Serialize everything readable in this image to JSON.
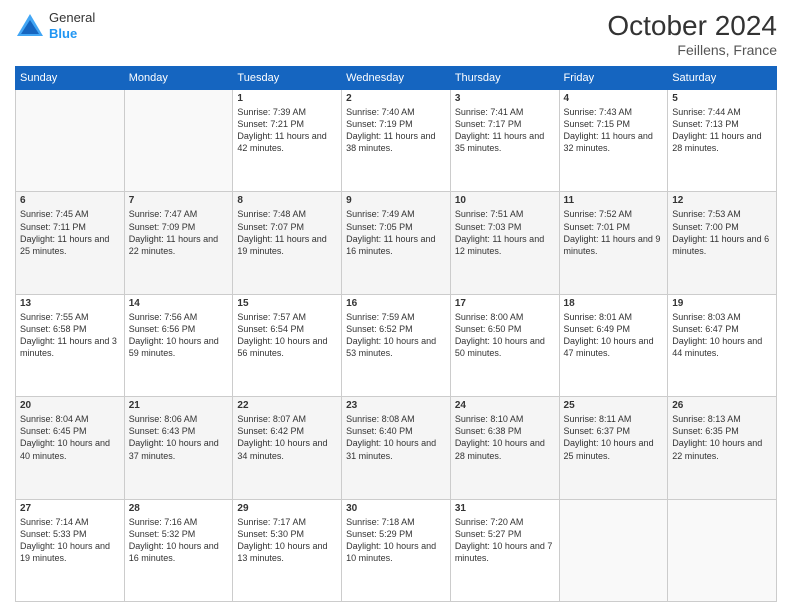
{
  "header": {
    "logo": {
      "general": "General",
      "blue": "Blue"
    },
    "title": "October 2024",
    "location": "Feillens, France"
  },
  "days_of_week": [
    "Sunday",
    "Monday",
    "Tuesday",
    "Wednesday",
    "Thursday",
    "Friday",
    "Saturday"
  ],
  "weeks": [
    [
      {
        "day": "",
        "info": ""
      },
      {
        "day": "",
        "info": ""
      },
      {
        "day": "1",
        "info": "Sunrise: 7:39 AM\nSunset: 7:21 PM\nDaylight: 11 hours and 42 minutes."
      },
      {
        "day": "2",
        "info": "Sunrise: 7:40 AM\nSunset: 7:19 PM\nDaylight: 11 hours and 38 minutes."
      },
      {
        "day": "3",
        "info": "Sunrise: 7:41 AM\nSunset: 7:17 PM\nDaylight: 11 hours and 35 minutes."
      },
      {
        "day": "4",
        "info": "Sunrise: 7:43 AM\nSunset: 7:15 PM\nDaylight: 11 hours and 32 minutes."
      },
      {
        "day": "5",
        "info": "Sunrise: 7:44 AM\nSunset: 7:13 PM\nDaylight: 11 hours and 28 minutes."
      }
    ],
    [
      {
        "day": "6",
        "info": "Sunrise: 7:45 AM\nSunset: 7:11 PM\nDaylight: 11 hours and 25 minutes."
      },
      {
        "day": "7",
        "info": "Sunrise: 7:47 AM\nSunset: 7:09 PM\nDaylight: 11 hours and 22 minutes."
      },
      {
        "day": "8",
        "info": "Sunrise: 7:48 AM\nSunset: 7:07 PM\nDaylight: 11 hours and 19 minutes."
      },
      {
        "day": "9",
        "info": "Sunrise: 7:49 AM\nSunset: 7:05 PM\nDaylight: 11 hours and 16 minutes."
      },
      {
        "day": "10",
        "info": "Sunrise: 7:51 AM\nSunset: 7:03 PM\nDaylight: 11 hours and 12 minutes."
      },
      {
        "day": "11",
        "info": "Sunrise: 7:52 AM\nSunset: 7:01 PM\nDaylight: 11 hours and 9 minutes."
      },
      {
        "day": "12",
        "info": "Sunrise: 7:53 AM\nSunset: 7:00 PM\nDaylight: 11 hours and 6 minutes."
      }
    ],
    [
      {
        "day": "13",
        "info": "Sunrise: 7:55 AM\nSunset: 6:58 PM\nDaylight: 11 hours and 3 minutes."
      },
      {
        "day": "14",
        "info": "Sunrise: 7:56 AM\nSunset: 6:56 PM\nDaylight: 10 hours and 59 minutes."
      },
      {
        "day": "15",
        "info": "Sunrise: 7:57 AM\nSunset: 6:54 PM\nDaylight: 10 hours and 56 minutes."
      },
      {
        "day": "16",
        "info": "Sunrise: 7:59 AM\nSunset: 6:52 PM\nDaylight: 10 hours and 53 minutes."
      },
      {
        "day": "17",
        "info": "Sunrise: 8:00 AM\nSunset: 6:50 PM\nDaylight: 10 hours and 50 minutes."
      },
      {
        "day": "18",
        "info": "Sunrise: 8:01 AM\nSunset: 6:49 PM\nDaylight: 10 hours and 47 minutes."
      },
      {
        "day": "19",
        "info": "Sunrise: 8:03 AM\nSunset: 6:47 PM\nDaylight: 10 hours and 44 minutes."
      }
    ],
    [
      {
        "day": "20",
        "info": "Sunrise: 8:04 AM\nSunset: 6:45 PM\nDaylight: 10 hours and 40 minutes."
      },
      {
        "day": "21",
        "info": "Sunrise: 8:06 AM\nSunset: 6:43 PM\nDaylight: 10 hours and 37 minutes."
      },
      {
        "day": "22",
        "info": "Sunrise: 8:07 AM\nSunset: 6:42 PM\nDaylight: 10 hours and 34 minutes."
      },
      {
        "day": "23",
        "info": "Sunrise: 8:08 AM\nSunset: 6:40 PM\nDaylight: 10 hours and 31 minutes."
      },
      {
        "day": "24",
        "info": "Sunrise: 8:10 AM\nSunset: 6:38 PM\nDaylight: 10 hours and 28 minutes."
      },
      {
        "day": "25",
        "info": "Sunrise: 8:11 AM\nSunset: 6:37 PM\nDaylight: 10 hours and 25 minutes."
      },
      {
        "day": "26",
        "info": "Sunrise: 8:13 AM\nSunset: 6:35 PM\nDaylight: 10 hours and 22 minutes."
      }
    ],
    [
      {
        "day": "27",
        "info": "Sunrise: 7:14 AM\nSunset: 5:33 PM\nDaylight: 10 hours and 19 minutes."
      },
      {
        "day": "28",
        "info": "Sunrise: 7:16 AM\nSunset: 5:32 PM\nDaylight: 10 hours and 16 minutes."
      },
      {
        "day": "29",
        "info": "Sunrise: 7:17 AM\nSunset: 5:30 PM\nDaylight: 10 hours and 13 minutes."
      },
      {
        "day": "30",
        "info": "Sunrise: 7:18 AM\nSunset: 5:29 PM\nDaylight: 10 hours and 10 minutes."
      },
      {
        "day": "31",
        "info": "Sunrise: 7:20 AM\nSunset: 5:27 PM\nDaylight: 10 hours and 7 minutes."
      },
      {
        "day": "",
        "info": ""
      },
      {
        "day": "",
        "info": ""
      }
    ]
  ]
}
